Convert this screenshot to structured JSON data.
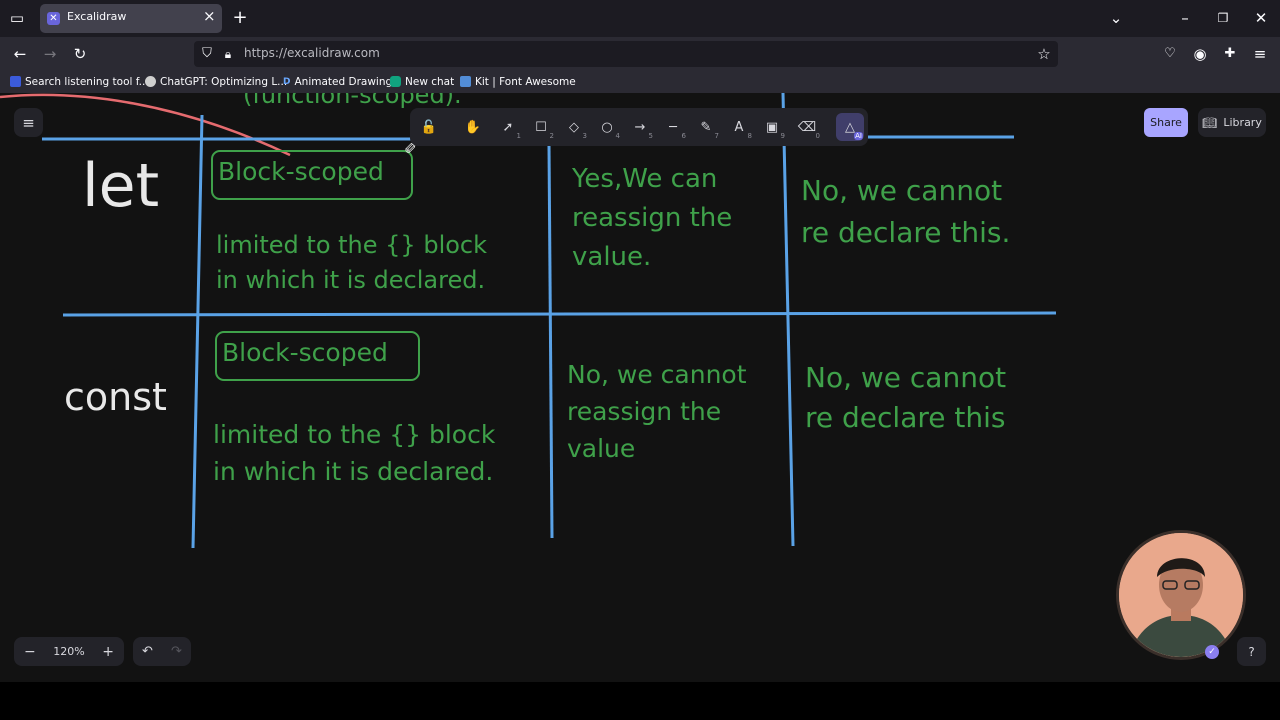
{
  "browser": {
    "tab_title": "Excalidraw",
    "tab_close": "×",
    "new_tab": "+",
    "url": "https://excalidraw.com",
    "bookmarks": [
      {
        "label": "Search listening tool f...",
        "color": "#3b5bdb"
      },
      {
        "label": "ChatGPT: Optimizing L...",
        "color": "#cfcfcf"
      },
      {
        "label": "Animated Drawings",
        "color": "#1e6fff"
      },
      {
        "label": "New chat",
        "color": "#10a37f"
      },
      {
        "label": "Kit | Font Awesome",
        "color": "#528dd7"
      }
    ],
    "bookmark_letters": {
      "animated": "D"
    }
  },
  "toolbar": {
    "tools": [
      {
        "icon": "lock-icon",
        "glyph": "🔓",
        "key": ""
      },
      {
        "icon": "hand-icon",
        "glyph": "✋",
        "key": ""
      },
      {
        "icon": "selection-icon",
        "glyph": "➚",
        "key": "1"
      },
      {
        "icon": "rectangle-icon",
        "glyph": "☐",
        "key": "2"
      },
      {
        "icon": "diamond-icon",
        "glyph": "◇",
        "key": "3"
      },
      {
        "icon": "ellipse-icon",
        "glyph": "○",
        "key": "4"
      },
      {
        "icon": "arrow-icon",
        "glyph": "→",
        "key": "5"
      },
      {
        "icon": "line-icon",
        "glyph": "─",
        "key": "6"
      },
      {
        "icon": "pencil-icon",
        "glyph": "✎",
        "key": "7"
      },
      {
        "icon": "text-icon",
        "glyph": "A",
        "key": "8"
      },
      {
        "icon": "image-icon",
        "glyph": "▣",
        "key": "9"
      },
      {
        "icon": "eraser-icon",
        "glyph": "⌫",
        "key": "0"
      },
      {
        "icon": "ai-shapes-icon",
        "glyph": "△",
        "key": "AI"
      }
    ],
    "share": "Share",
    "library": "Library"
  },
  "zoom": {
    "minus": "−",
    "level": "120%",
    "plus": "+"
  },
  "drawing": {
    "top_partial": "(function-scoped).",
    "rows": [
      {
        "label": "let",
        "scope_box": "Block-scoped",
        "scope_desc_1": "limited to the {} block",
        "scope_desc_2": "in which it is declared.",
        "reassign_1": "Yes,We can",
        "reassign_2": "reassign the",
        "reassign_3": "value.",
        "redeclare_1": "No, we cannot",
        "redeclare_2": "re declare this."
      },
      {
        "label": "const",
        "scope_box": "Block-scoped",
        "scope_desc_1": "limited to the {} block",
        "scope_desc_2": "in which it is declared.",
        "reassign_1": "No, we cannot",
        "reassign_2": "reassign the",
        "reassign_3": "value",
        "redeclare_1": "No, we cannot",
        "redeclare_2": "re declare this"
      }
    ]
  },
  "colors": {
    "ink_green": "#3fa14a",
    "grid_blue": "#5aa2e6",
    "accent_purple": "#a8a5ff",
    "pen_red": "#e56b6f"
  }
}
